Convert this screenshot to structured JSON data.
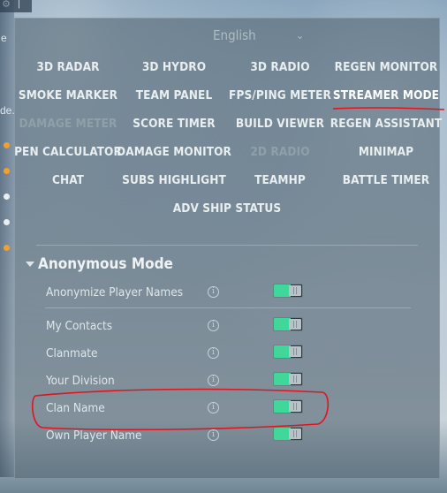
{
  "colors": {
    "panel_bg": "#56687499",
    "text": "#e9eef0",
    "disabled_text": "#8fa0a8",
    "toggle_on": "#3fd79a",
    "annotation": "#e0141e"
  },
  "top_fragment": {
    "icon": "settings-icon",
    "sep": "|"
  },
  "left_strip": {
    "frag_e": "e",
    "frag_de": "de.",
    "dots": [
      "#f0a030",
      "#f0a030",
      "#e8eef2",
      "#e8eef2",
      "#f0a030"
    ]
  },
  "language": {
    "label": "English",
    "chevron": "chevron-down-icon",
    "chevron_glyph": "⌄"
  },
  "mods": [
    "3D RADAR",
    "3D HYDRO",
    "3D RADIO",
    "REGEN MONITOR",
    "SMOKE MARKER",
    "TEAM PANEL",
    "FPS/PING METER",
    "STREAMER MODE",
    "DAMAGE METER",
    "SCORE TIMER",
    "BUILD VIEWER",
    "REGEN ASSISTANT",
    "PEN CALCULATOR",
    "DAMAGE MONITOR",
    "2D RADIO",
    "MINIMAP",
    "CHAT",
    "SUBS HIGHLIGHT",
    "TEAMHP",
    "BATTLE TIMER",
    "ADV SHIP STATUS"
  ],
  "section": {
    "title": "Anonymous Mode",
    "options": [
      {
        "label": "Anonymize Player Names",
        "enabled": true
      },
      {
        "label": "My Contacts",
        "enabled": true
      },
      {
        "label": "Clanmate",
        "enabled": true
      },
      {
        "label": "Your Division",
        "enabled": true
      },
      {
        "label": "Clan Name",
        "enabled": true
      },
      {
        "label": "Own Player Name",
        "enabled": true
      }
    ],
    "info_glyph": "i",
    "knob_glyph": "||"
  }
}
